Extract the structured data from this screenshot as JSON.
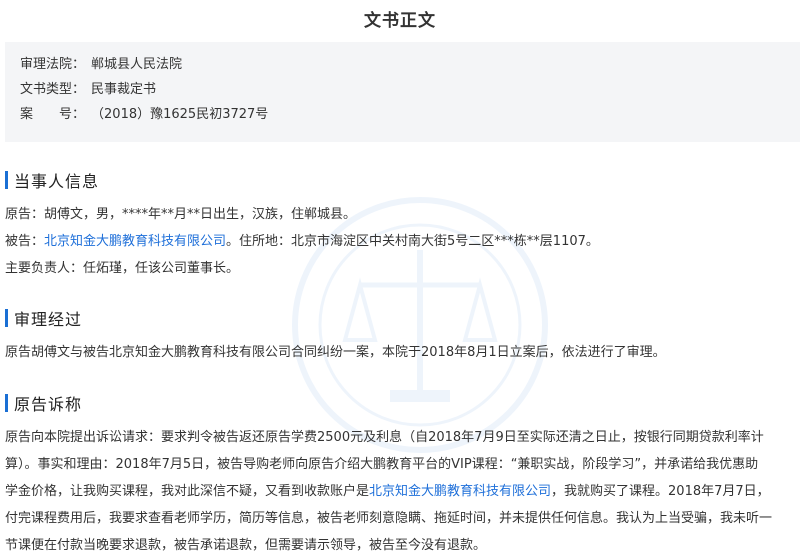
{
  "title": "文书正文",
  "meta": {
    "court_label": "审理法院",
    "court_value": "郸城县人民法院",
    "doctype_label": "文书类型",
    "doctype_value": "民事裁定书",
    "caseno_label": "案　　号",
    "caseno_value": "（2018）豫1625民初3727号"
  },
  "parties": {
    "heading": "当事人信息",
    "plaintiff": "原告：胡傅文，男，****年**月**日出生，汉族，住郸城县。",
    "defendant_prefix": "被告：",
    "defendant_link": "北京知金大鹏教育科技有限公司",
    "defendant_suffix": "。住所地：北京市海淀区中关村南大街5号二区***栋**层1107。",
    "principal": "主要负责人：任炻瑾，任该公司董事长。"
  },
  "trial": {
    "heading": "审理经过",
    "text": "原告胡傅文与被告北京知金大鹏教育科技有限公司合同纠纷一案，本院于2018年8月1日立案后，依法进行了审理。"
  },
  "claim": {
    "heading": "原告诉称",
    "line1": "原告向本院提出诉讼请求：要求判令被告返还原告学费2500元及利息（自2018年7月9日至实际还清之日止，按银行同期贷款利率计",
    "line2": "算）。事实和理由：2018年7月5日，被告导购老师向原告介绍大鹏教育平台的VIP课程：“兼职实战，阶段学习”，并承诺给我优惠助",
    "line3_prefix": "学金价格，让我购买课程，我对此深信不疑，又看到收款账户是",
    "line3_link": "北京知金大鹏教育科技有限公司",
    "line3_suffix": "，我就购买了课程。2018年7月7日，",
    "line4": "付完课程费用后，我要求查看老师学历，简历等信息，被告老师刻意隐瞒、拖延时间，并未提供任何信息。我认为上当受骗，我未听一",
    "line5": "节课便在付款当晚要求退款，被告承诺退款，但需要请示领导，被告至今没有退款。"
  },
  "colors": {
    "accent": "#1a6fd4",
    "link": "#1e6fd9",
    "info_bg": "#f4f5f7"
  },
  "icons": {
    "watermark": "court-emblem-watermark"
  }
}
